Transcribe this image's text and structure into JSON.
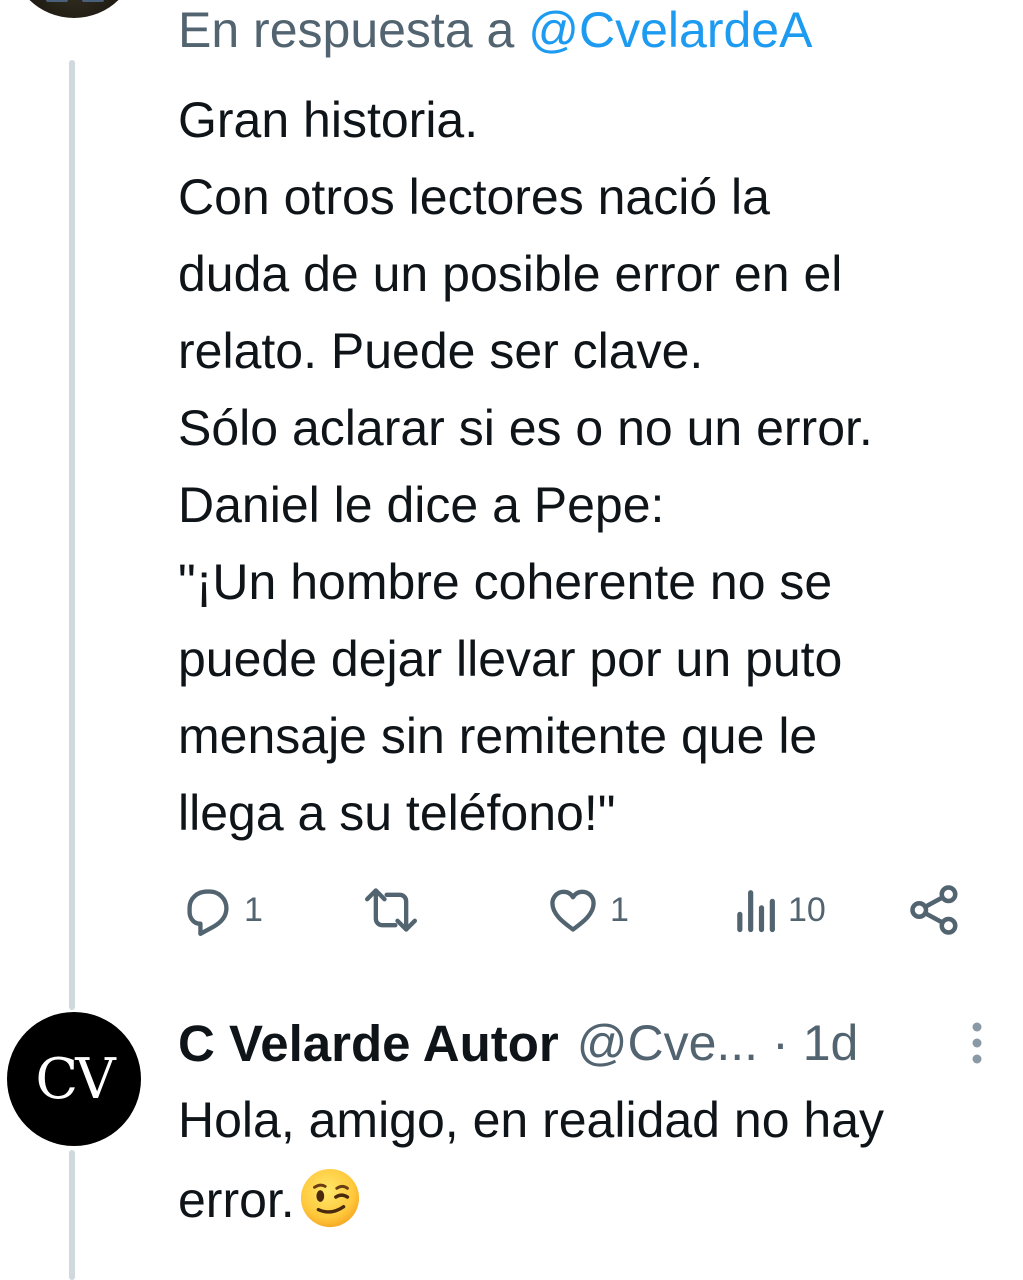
{
  "tweet": {
    "reply_prefix": "En respuesta a ",
    "reply_handle": "@CvelardeA",
    "text": "Gran historia.\nCon otros lectores nació la\nduda de un posible error en el\nrelato. Puede ser clave.\nSólo aclarar si es o no un error.\nDaniel le dice a Pepe:\n\"¡Un hombre coherente no se\npuede dejar llevar por un puto\nmensaje sin remitente que le\nllega a su teléfono!\"",
    "actions": {
      "reply_count": "1",
      "repost_count": "",
      "like_count": "1",
      "views_count": "10"
    }
  },
  "reply": {
    "avatar_text": "CV",
    "author_name": "C Velarde Autor",
    "handle": "@Cve...",
    "separator": "·",
    "time": "1d",
    "text": "Hola, amigo, en realidad no hay\nerror.",
    "emoji": "winking-face"
  },
  "colors": {
    "text": "#0f1419",
    "secondary": "#536471",
    "link": "#1d9bf0",
    "thread_line": "#cfd9de"
  }
}
